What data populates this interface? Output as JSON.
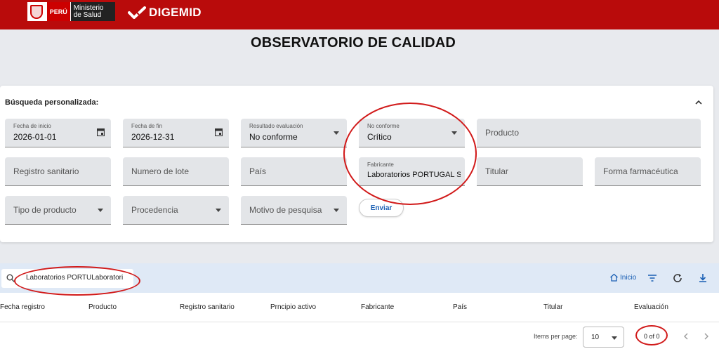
{
  "header": {
    "country": "PERÚ",
    "ministry_line1": "Ministerio",
    "ministry_line2": "de Salud",
    "brand": "DIGEMID"
  },
  "page_title": "OBSERVATORIO DE CALIDAD",
  "search_panel": {
    "heading": "Búsqueda personalizada:",
    "fields": {
      "start_date": {
        "label": "Fecha de inicio",
        "value": "2026-01-01"
      },
      "end_date": {
        "label": "Fecha de fin",
        "value": "2026-12-31"
      },
      "result": {
        "label": "Resultado evaluación",
        "value": "No conforme"
      },
      "nonconform": {
        "label": "No conforme",
        "value": "Crítico"
      },
      "product": {
        "placeholder": "Producto"
      },
      "registry": {
        "placeholder": "Registro sanitario"
      },
      "lot": {
        "placeholder": "Numero de lote"
      },
      "country": {
        "placeholder": "País"
      },
      "manufacturer": {
        "label": "Fabricante",
        "value": "Laboratorios PORTUGAL S"
      },
      "holder": {
        "placeholder": "Titular"
      },
      "form": {
        "placeholder": "Forma farmacéutica"
      },
      "product_type": {
        "placeholder": "Tipo de producto"
      },
      "origin": {
        "placeholder": "Procedencia"
      },
      "reason": {
        "placeholder": "Motivo de pesquisa"
      }
    },
    "submit_label": "Enviar"
  },
  "results": {
    "search_value": "Laboratorios PORTULaboratori",
    "home_label": "Inicio",
    "columns": [
      "Fecha registro",
      "Producto",
      "Registro sanitario",
      "Prncipio activo",
      "Fabricante",
      "País",
      "Titular",
      "Evaluación"
    ],
    "paginator": {
      "items_per_page_label": "Items per page:",
      "page_size": "10",
      "range": "0 of 0"
    }
  },
  "colors": {
    "brand_red": "#b90b0b",
    "accent_blue": "#1a5fb4",
    "annotation_red": "#d11a1a"
  }
}
